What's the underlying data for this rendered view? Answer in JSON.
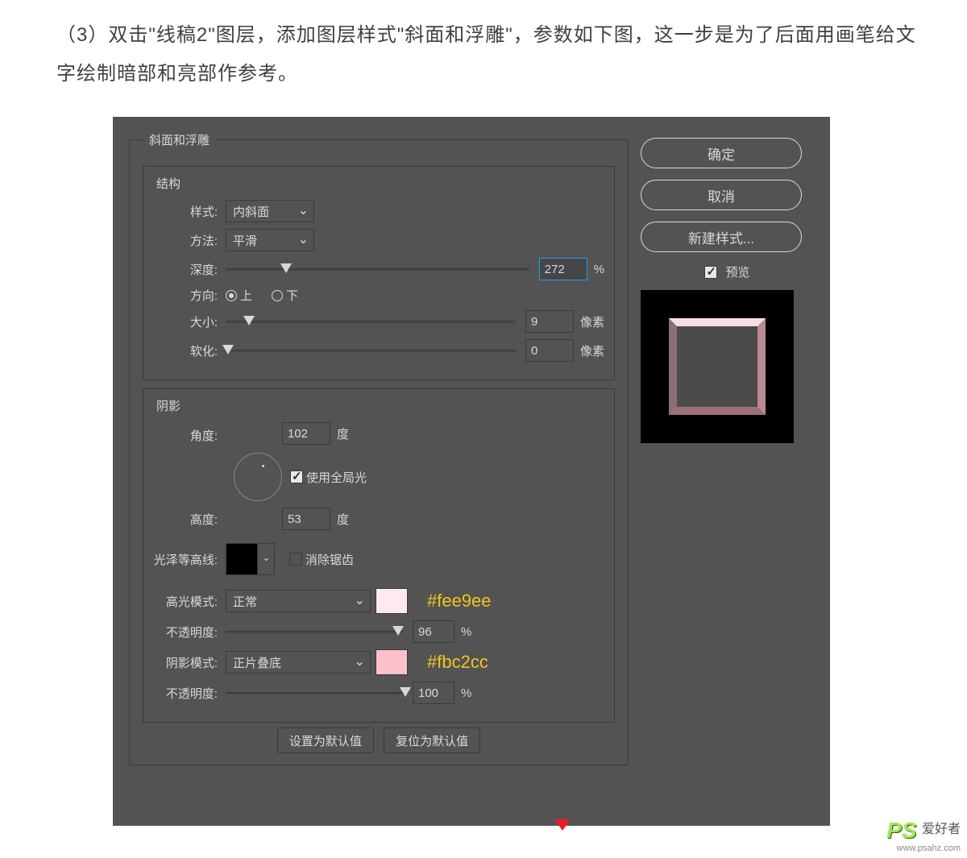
{
  "tutorial": {
    "paragraph": "（3）双击\"线稿2\"图层，添加图层样式\"斜面和浮雕\"，参数如下图，这一步是为了后面用画笔给文字绘制暗部和亮部作参考。"
  },
  "dialog": {
    "fieldset_title": "斜面和浮雕",
    "structure": {
      "title": "结构",
      "style_label": "样式:",
      "style_value": "内斜面",
      "technique_label": "方法:",
      "technique_value": "平滑",
      "depth_label": "深度:",
      "depth_value": "272",
      "depth_unit": "%",
      "direction_label": "方向:",
      "direction_up": "上",
      "direction_down": "下",
      "size_label": "大小:",
      "size_value": "9",
      "size_unit": "像素",
      "soften_label": "软化:",
      "soften_value": "0",
      "soften_unit": "像素"
    },
    "shading": {
      "title": "阴影",
      "angle_label": "角度:",
      "angle_value": "102",
      "angle_unit": "度",
      "global_light": "使用全局光",
      "altitude_label": "高度:",
      "altitude_value": "53",
      "altitude_unit": "度",
      "gloss_label": "光泽等高线:",
      "antialias": "消除锯齿",
      "highlight_mode_label": "高光模式:",
      "highlight_mode_value": "正常",
      "highlight_color": "#fee9ee",
      "highlight_color_annot": "#fee9ee",
      "highlight_opacity_label": "不透明度:",
      "highlight_opacity_value": "96",
      "highlight_opacity_unit": "%",
      "shadow_mode_label": "阴影模式:",
      "shadow_mode_value": "正片叠底",
      "shadow_color": "#fbc2cc",
      "shadow_color_annot": "#fbc2cc",
      "shadow_opacity_label": "不透明度:",
      "shadow_opacity_value": "100",
      "shadow_opacity_unit": "%"
    },
    "bottom": {
      "make_default": "设置为默认值",
      "reset_default": "复位为默认值"
    },
    "right": {
      "ok": "确定",
      "cancel": "取消",
      "new_style": "新建样式...",
      "preview": "预览"
    }
  },
  "watermark": {
    "logo": "PS",
    "cn": "爱好者",
    "url": "www.psahz.com"
  }
}
